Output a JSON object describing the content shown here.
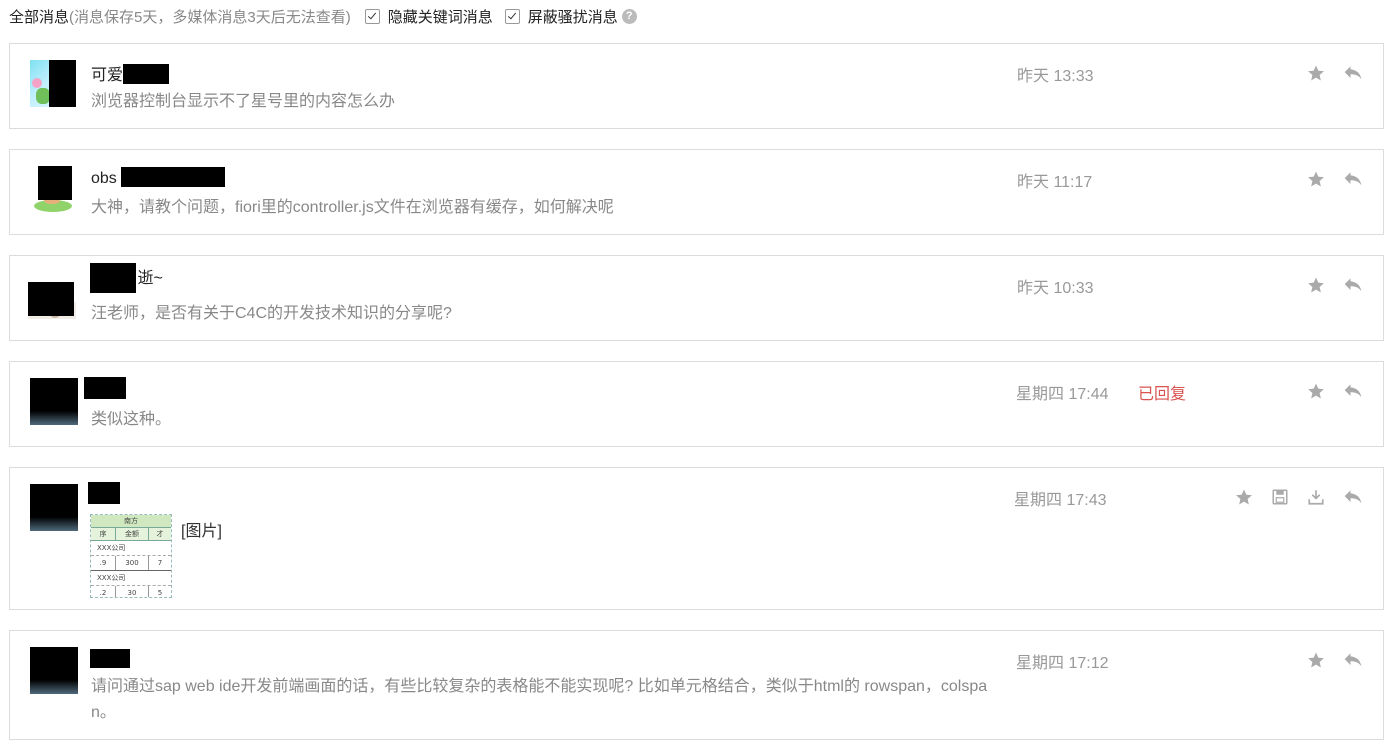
{
  "filter": {
    "all_label": "全部消息",
    "note": "(消息保存5天，多媒体消息3天后无法查看)",
    "hide_keywords": "隐藏关键词消息",
    "block_spam": "屏蔽骚扰消息",
    "help_icon": "?"
  },
  "messages": [
    {
      "name": "可爱",
      "text": "浏览器控制台显示不了星号里的内容怎么办",
      "time": "昨天 13:33",
      "status": ""
    },
    {
      "name": "obs",
      "text": "大神，请教个问题，fiori里的controller.js文件在浏览器有缓存，如何解决呢",
      "time": "昨天 11:17",
      "status": ""
    },
    {
      "name": "逝~",
      "text": "汪老师，是否有关于C4C的开发技术知识的分享呢?",
      "time": "昨天 10:33",
      "status": ""
    },
    {
      "name": "",
      "text": "类似这种。",
      "time": "星期四 17:44",
      "status": "已回复"
    },
    {
      "name": "",
      "text": "[图片]",
      "time": "星期四 17:43",
      "status": "",
      "thumb": {
        "header": "南方",
        "c1": "序",
        "c2": "金额",
        "c3": "才",
        "r1": "XXX公司",
        "v1": ".9",
        "v2": "300",
        "v3": "7",
        "r2": "XXX公司",
        "v4": ".2",
        "v5": "30",
        "v6": "5"
      }
    },
    {
      "name": "",
      "text": "请问通过sap web ide开发前端画面的话，有些比较复杂的表格能不能实现呢? 比如单元格结合，类似于html的 rowspan，colspa",
      "text2": "n。",
      "time": "星期四 17:12",
      "status": ""
    }
  ]
}
